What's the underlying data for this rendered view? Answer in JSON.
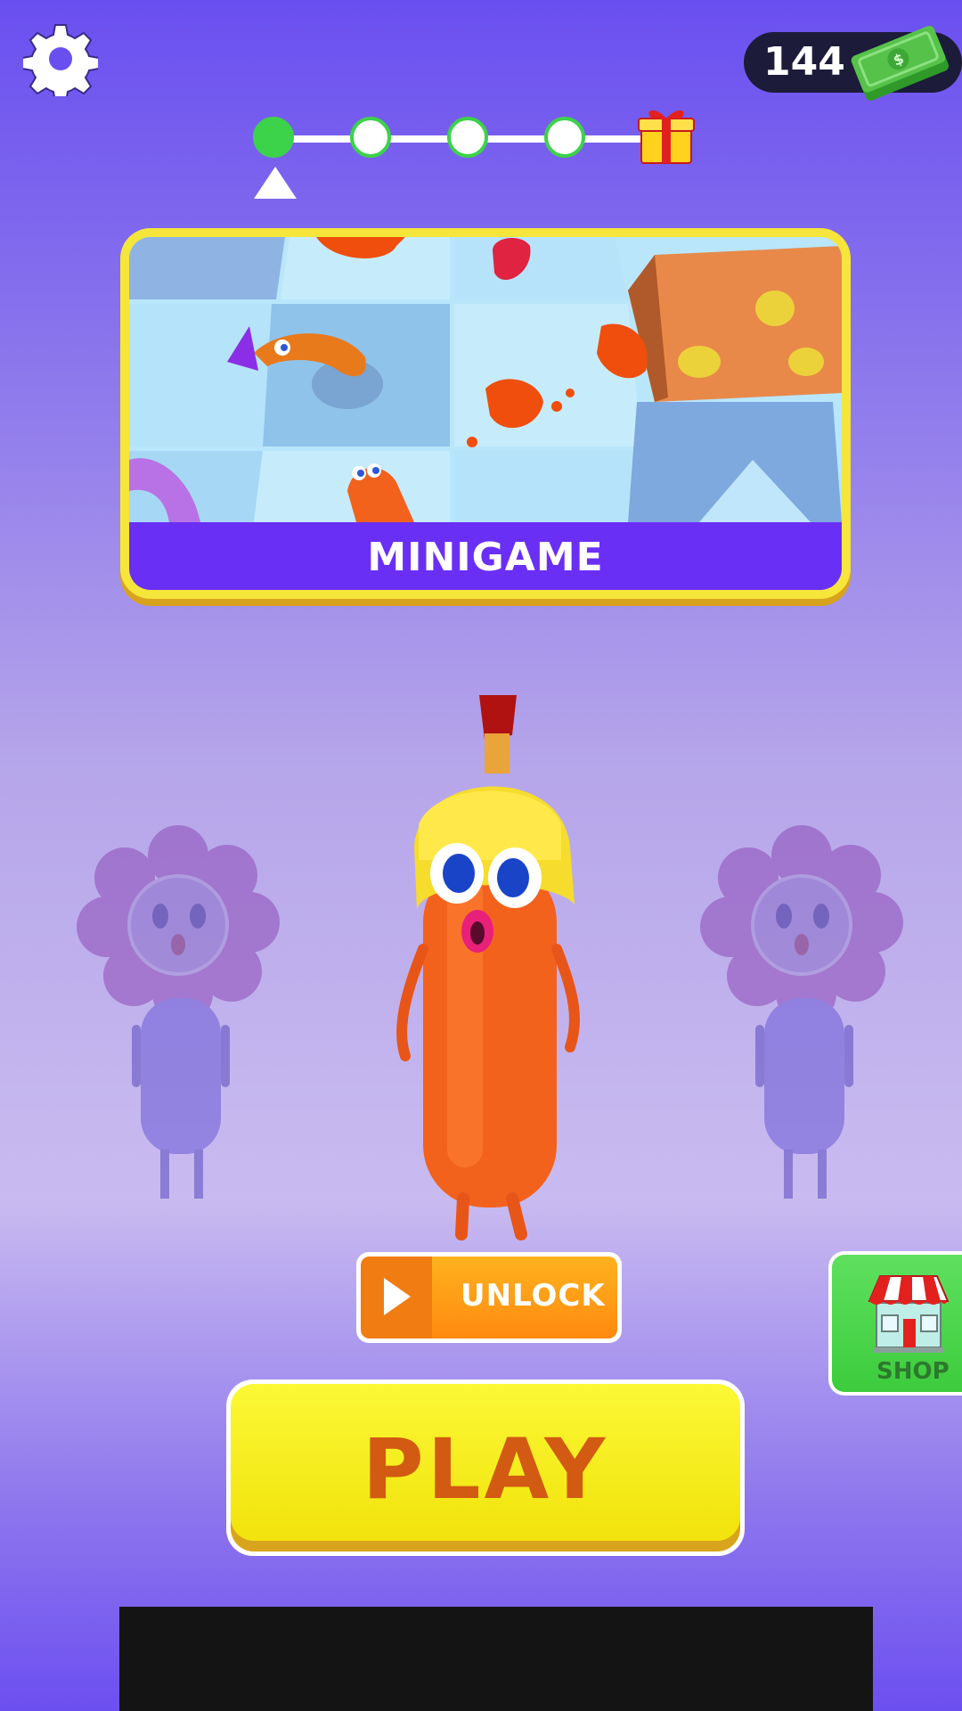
{
  "currency": {
    "amount": "144"
  },
  "progress": {
    "total_steps": 5,
    "completed": 1
  },
  "minigame": {
    "label": "MINIGAME"
  },
  "unlock": {
    "label": "UNLOCK"
  },
  "shop": {
    "label": "SHOP"
  },
  "play": {
    "label": "PLAY"
  },
  "colors": {
    "accent_purple": "#6a2ff5",
    "play_yellow": "#f2e50f",
    "play_text": "#d25a12",
    "progress_green": "#3cd24a",
    "shop_green": "#3ccc3c",
    "unlock_orange": "#ff8a10"
  },
  "icons": [
    "gear-icon",
    "cash-icon",
    "gift-icon",
    "progress-marker-icon",
    "video-icon",
    "shop-icon"
  ]
}
